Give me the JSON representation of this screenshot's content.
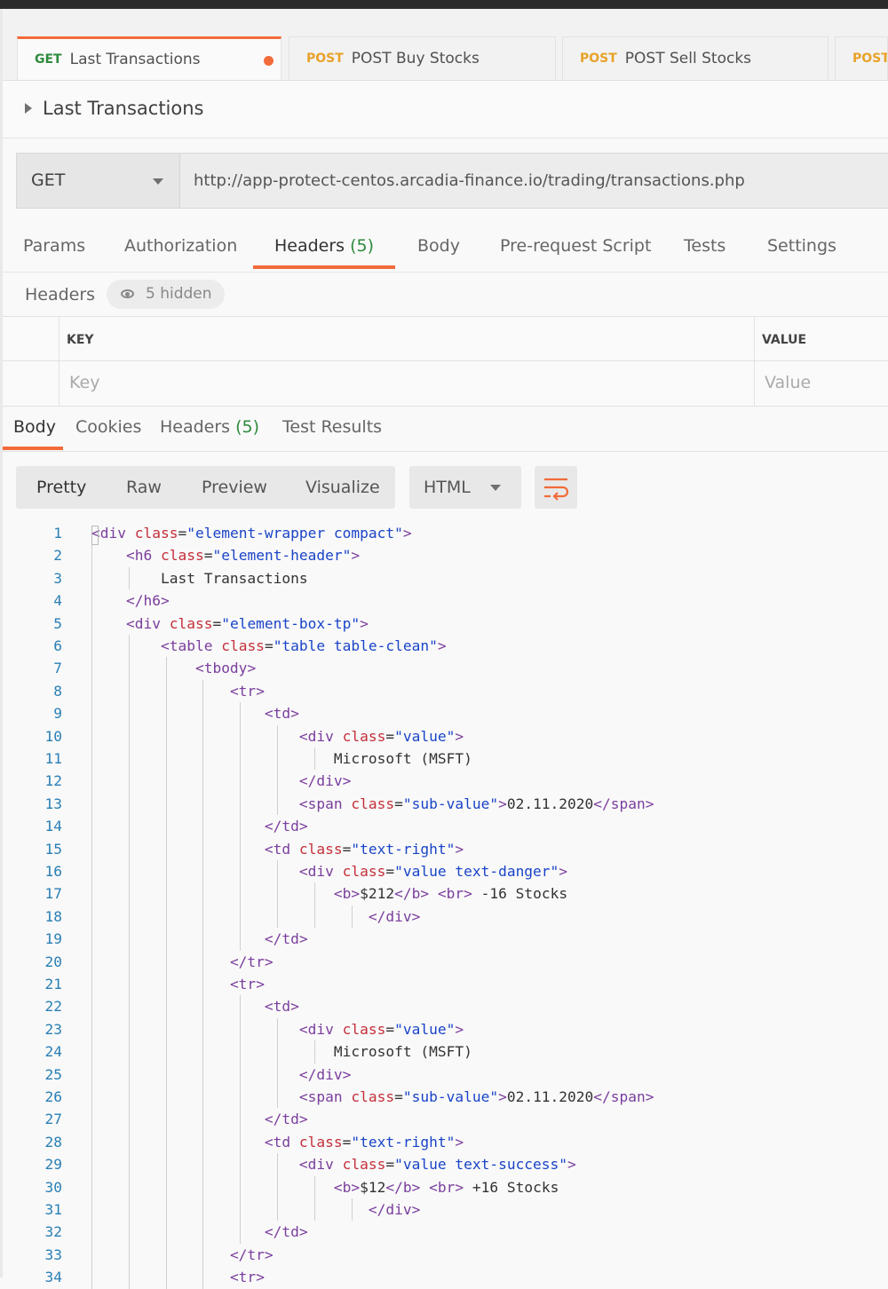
{
  "request_tabs": [
    {
      "method": "GET",
      "label": "Last Transactions",
      "active": true,
      "unsaved": true
    },
    {
      "method": "POST",
      "label": "POST Buy Stocks"
    },
    {
      "method": "POST",
      "label": "POST Sell Stocks"
    },
    {
      "method": "POST",
      "label": ""
    }
  ],
  "request": {
    "name": "Last Transactions",
    "method": "GET",
    "url": "http://app-protect-centos.arcadia-finance.io/trading/transactions.php"
  },
  "request_subtabs": [
    {
      "label": "Params"
    },
    {
      "label": "Authorization"
    },
    {
      "label": "Headers",
      "count": "(5)",
      "active": true
    },
    {
      "label": "Body"
    },
    {
      "label": "Pre-request Script"
    },
    {
      "label": "Tests"
    },
    {
      "label": "Settings"
    }
  ],
  "headers_section": {
    "label": "Headers",
    "hidden_text": "5 hidden",
    "key_header": "KEY",
    "value_header": "VALUE",
    "key_placeholder": "Key",
    "value_placeholder": "Value"
  },
  "response_tabs": [
    {
      "label": "Body",
      "active": true
    },
    {
      "label": "Cookies"
    },
    {
      "label": "Headers",
      "count": "(5)"
    },
    {
      "label": "Test Results"
    }
  ],
  "view_modes": [
    "Pretty",
    "Raw",
    "Preview",
    "Visualize"
  ],
  "format": "HTML",
  "colors": {
    "accent": "#f26b3a",
    "get": "#2e8b3d",
    "post": "#e8a22a",
    "line_numbers": "#2a7fb5"
  },
  "code_lines": [
    "<div class=\"element-wrapper compact\">",
    "    <h6 class=\"element-header\">",
    "        Last Transactions",
    "    </h6>",
    "    <div class=\"element-box-tp\">",
    "        <table class=\"table table-clean\">",
    "            <tbody>",
    "                <tr>",
    "                    <td>",
    "                        <div class=\"value\">",
    "                            Microsoft (MSFT)",
    "                        </div>",
    "                        <span class=\"sub-value\">02.11.2020</span>",
    "                    </td>",
    "                    <td class=\"text-right\">",
    "                        <div class=\"value text-danger\">",
    "                            <b>$212</b> <br> -16 Stocks",
    "                                </div>",
    "                    </td>",
    "                </tr>",
    "                <tr>",
    "                    <td>",
    "                        <div class=\"value\">",
    "                            Microsoft (MSFT)",
    "                        </div>",
    "                        <span class=\"sub-value\">02.11.2020</span>",
    "                    </td>",
    "                    <td class=\"text-right\">",
    "                        <div class=\"value text-success\">",
    "                            <b>$12</b> <br> +16 Stocks",
    "                                </div>",
    "                    </td>",
    "                </tr>",
    "                <tr>"
  ]
}
